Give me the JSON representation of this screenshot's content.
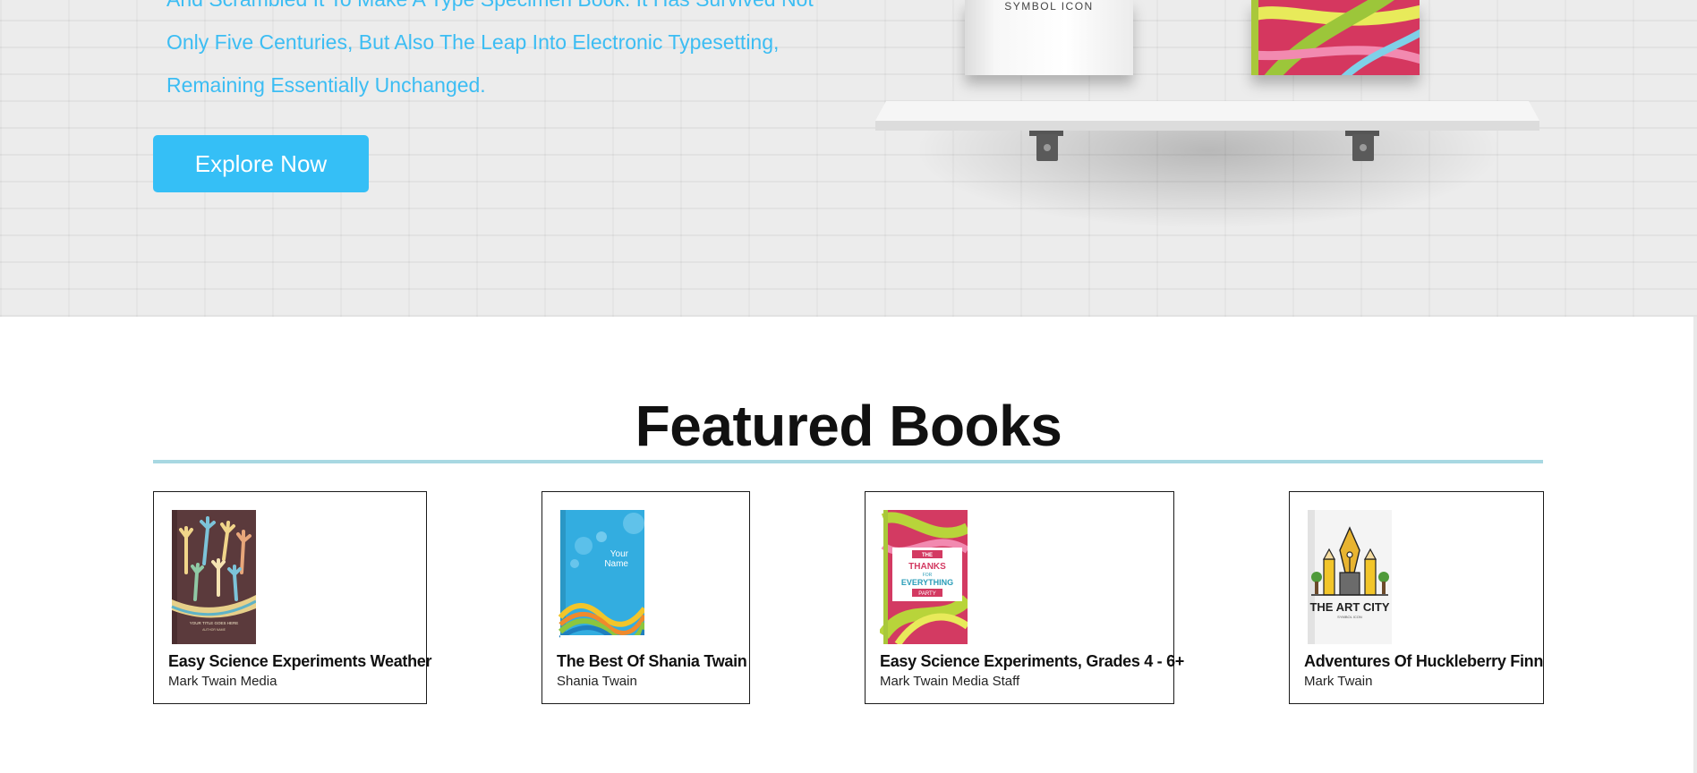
{
  "hero": {
    "lines": [
      "And Scrambled It To Make A Type Specimen Book. It Has Survived Not",
      "Only Five Centuries, But Also The Leap Into Electronic Typesetting,",
      "Remaining Essentially Unchanged."
    ],
    "explore_label": "Explore Now",
    "shelf_book_label": "SYMBOL ICON"
  },
  "featured": {
    "title": "Featured Books",
    "books": [
      {
        "title": "Easy Science Experiments Weather",
        "author": "Mark Twain Media",
        "cover_text": [
          "YOUR TITLE GOES HERE",
          "AUTHOR NAME"
        ]
      },
      {
        "title": "The Best Of Shania Twain",
        "author": "Shania Twain",
        "cover_text": [
          "Your",
          "Name"
        ]
      },
      {
        "title": "Easy Science Experiments, Grades 4 - 6+",
        "author": "Mark Twain Media Staff",
        "cover_text": [
          "THE",
          "THANKS",
          "FOR",
          "EVERYTHING",
          "PARTY"
        ]
      },
      {
        "title": "Adventures Of Huckleberry Finn",
        "author": "Mark Twain",
        "cover_text": [
          "THE ART CITY",
          "SYMBOL ICON"
        ]
      }
    ]
  },
  "colors": {
    "accent": "#35bff6",
    "hero_text": "#3cbdf3",
    "rule": "#a8d8e2"
  }
}
